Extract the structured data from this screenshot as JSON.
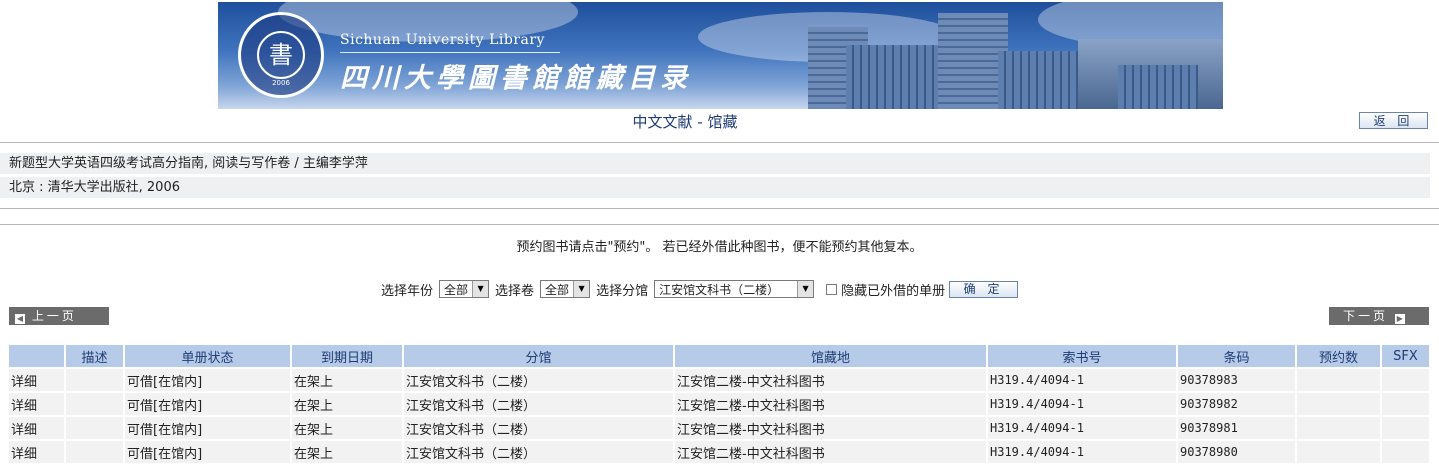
{
  "banner": {
    "seal_year": "2006",
    "seal_char": "書",
    "english_name": "Sichuan University Library",
    "chinese_name": "四川大學圖書館館藏目录"
  },
  "page_title": "中文文献 - 馆藏",
  "back_label": "返 回",
  "record": {
    "title_line": "新题型大学英语四级考试高分指南, 阅读与写作卷 / 主编李学萍",
    "pub_line": "北京 : 清华大学出版社, 2006"
  },
  "notice": "预约图书请点击\"预约\"。 若已经外借此种图书，便不能预约其他复本。",
  "filters": {
    "year_label": "选择年份",
    "year_value": "全部",
    "volume_label": "选择卷",
    "volume_value": "全部",
    "branch_label": "选择分馆",
    "branch_value": "江安馆文科书（二楼）",
    "hide_label": "隐藏已外借的单册",
    "ok_label": "确 定"
  },
  "pager": {
    "prev": "上一页",
    "next": "下一页"
  },
  "table": {
    "headers": [
      "",
      "描述",
      "单册状态",
      "到期日期",
      "分馆",
      "馆藏地",
      "索书号",
      "条码",
      "预约数",
      "SFX"
    ],
    "rows": [
      [
        "详细",
        "",
        "可借[在馆内]",
        "在架上",
        "江安馆文科书（二楼）",
        "江安馆二楼-中文社科图书",
        "H319.4/4094-1",
        "90378983",
        "",
        ""
      ],
      [
        "详细",
        "",
        "可借[在馆内]",
        "在架上",
        "江安馆文科书（二楼）",
        "江安馆二楼-中文社科图书",
        "H319.4/4094-1",
        "90378982",
        "",
        ""
      ],
      [
        "详细",
        "",
        "可借[在馆内]",
        "在架上",
        "江安馆文科书（二楼）",
        "江安馆二楼-中文社科图书",
        "H319.4/4094-1",
        "90378981",
        "",
        ""
      ],
      [
        "详细",
        "",
        "可借[在馆内]",
        "在架上",
        "江安馆文科书（二楼）",
        "江安馆二楼-中文社科图书",
        "H319.4/4094-1",
        "90378980",
        "",
        ""
      ]
    ]
  }
}
